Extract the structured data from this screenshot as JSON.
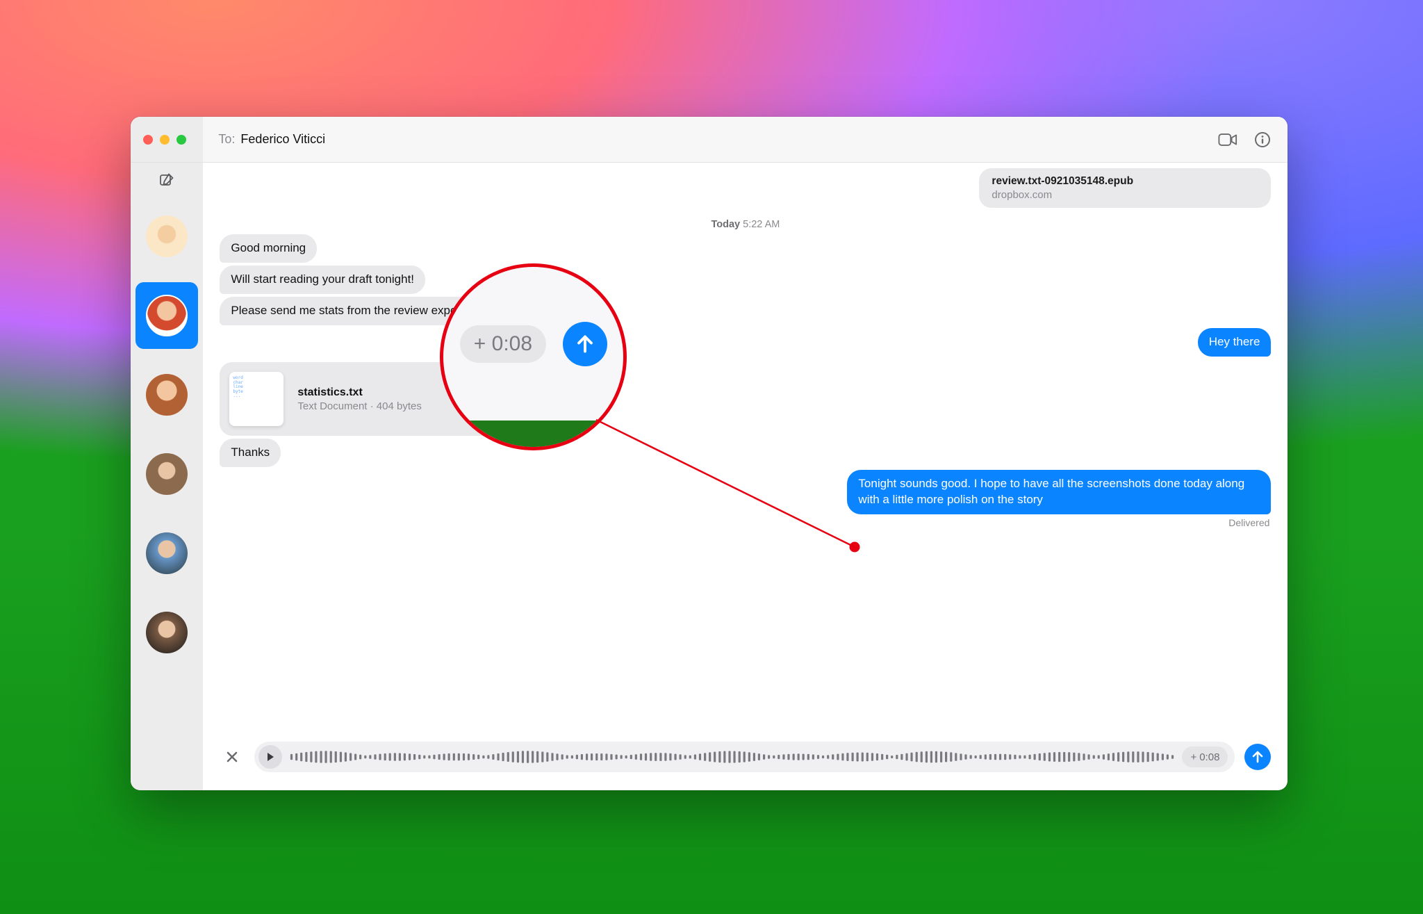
{
  "header": {
    "to_label": "To:",
    "recipient": "Federico Viticci"
  },
  "attachment_top": {
    "filename": "review.txt-0921035148.epub",
    "domain": "dropbox.com"
  },
  "timestamp": {
    "day": "Today",
    "time": "5:22 AM"
  },
  "incoming": {
    "m1": "Good morning",
    "m2": "Will start reading your draft tonight!",
    "m3": "Please send me stats from the review export",
    "m4": "Thanks"
  },
  "outgoing": {
    "hey": "Hey there",
    "long": "Tonight sounds good. I hope to have all the screenshots done today along with a little more polish on the story"
  },
  "file_card": {
    "name": "statistics.txt",
    "subtitle": "Text Document · 404 bytes"
  },
  "status": {
    "delivered": "Delivered"
  },
  "voice": {
    "duration_prefix": "+",
    "duration": "0:08"
  }
}
